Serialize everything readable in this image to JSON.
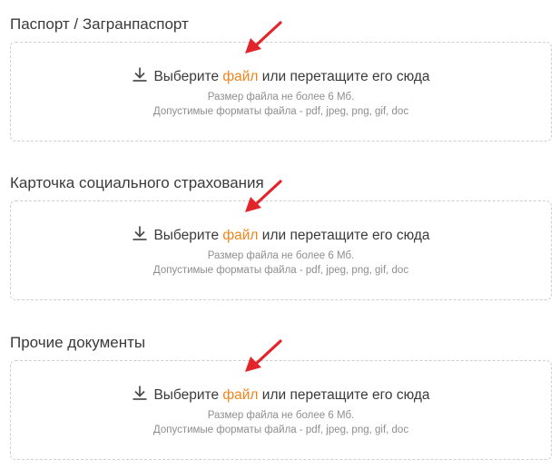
{
  "colors": {
    "accent": "#f0841c",
    "arrow": "#e3252b",
    "border": "#cfcfcf",
    "hint": "#8e8e8e"
  },
  "icons": {
    "upload": "download-arrow-icon",
    "annotation": "red-arrow-annotation"
  },
  "sections": [
    {
      "title": "Паспорт / Загранпаспорт",
      "dropzone": {
        "prefix": "Выберите",
        "link": "файл",
        "suffix": "или перетащите его сюда",
        "size_hint": "Размер файла не более 6 Мб.",
        "formats_hint": "Допустимые форматы файла - pdf, jpeg, png, gif, doc"
      }
    },
    {
      "title": "Карточка социального страхования",
      "dropzone": {
        "prefix": "Выберите",
        "link": "файл",
        "suffix": "или перетащите его сюда",
        "size_hint": "Размер файла не более 6 Мб.",
        "formats_hint": "Допустимые форматы файла - pdf, jpeg, png, gif, doc"
      }
    },
    {
      "title": "Прочие документы",
      "dropzone": {
        "prefix": "Выберите",
        "link": "файл",
        "suffix": "или перетащите его сюда",
        "size_hint": "Размер файла не более 6 Мб.",
        "formats_hint": "Допустимые форматы файла - pdf, jpeg, png, gif, doc"
      }
    }
  ]
}
